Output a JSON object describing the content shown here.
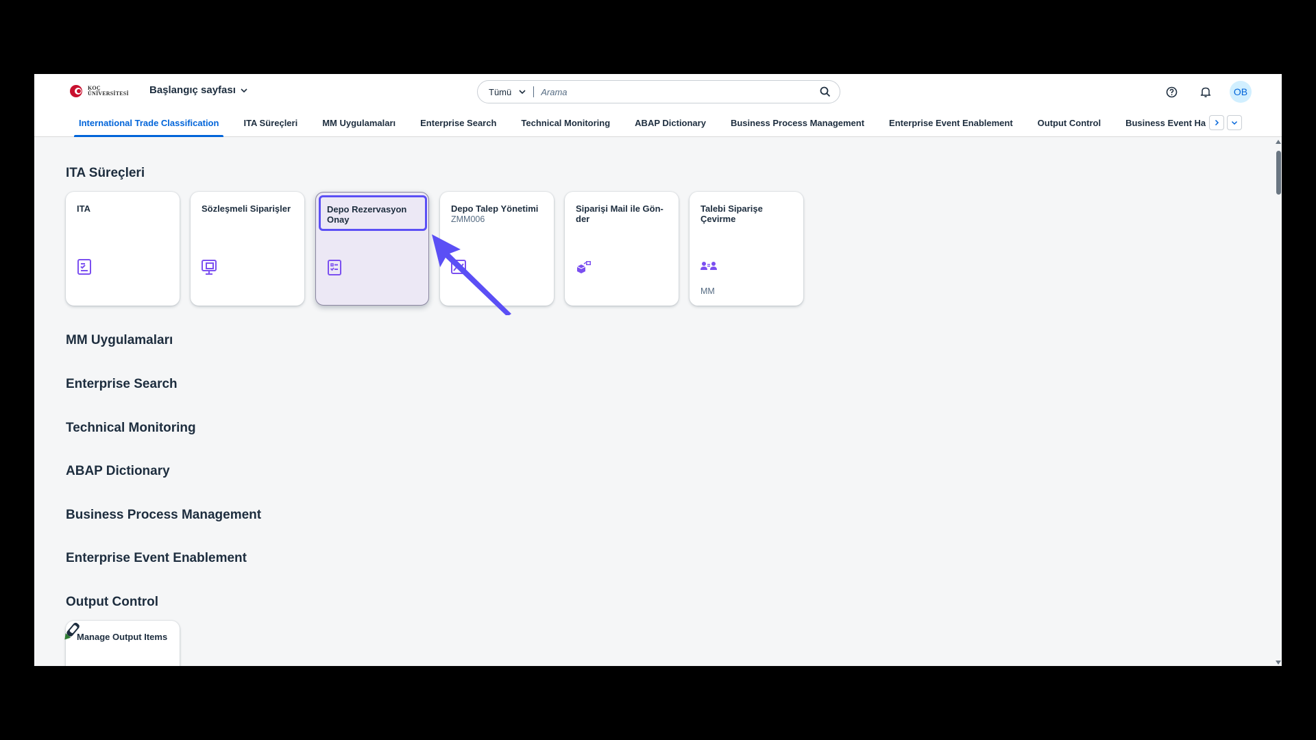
{
  "shell": {
    "logo_line1": "KOÇ",
    "logo_line2": "ÜNİVERSİTESİ",
    "home_title": "Başlangıç sayfası",
    "search": {
      "scope": "Tümü",
      "placeholder": "Arama"
    },
    "avatar_initials": "OB"
  },
  "tabs": [
    {
      "label": "International Trade Classification",
      "active": true
    },
    {
      "label": "ITA Süreçleri"
    },
    {
      "label": "MM Uygulamaları"
    },
    {
      "label": "Enterprise Search"
    },
    {
      "label": "Technical Monitoring"
    },
    {
      "label": "ABAP Dictionary"
    },
    {
      "label": "Business Process Management"
    },
    {
      "label": "Enterprise Event Enablement"
    },
    {
      "label": "Output Control"
    },
    {
      "label": "Business Event Ha"
    }
  ],
  "sections": {
    "ita": "ITA Süreçleri",
    "mm": "MM Uygulamaları",
    "es": "Enterprise Search",
    "tm": "Technical Monitoring",
    "abap": "ABAP Dictionary",
    "bpm": "Business Process Management",
    "eee": "Enterprise Event Enablement",
    "oc": "Output Control"
  },
  "tiles": {
    "ita": {
      "title": "ITA",
      "icon": "clipboard-list-icon"
    },
    "sozlesmeli": {
      "title": "Sözleşmeli Siparişler",
      "icon": "monitor-copy-icon"
    },
    "depo_rez": {
      "title": "Depo Rezervasyon Onay",
      "icon": "checklist-icon"
    },
    "depo_talep": {
      "title": "Depo Talep Yönetimi",
      "subtitle": "ZMM006",
      "icon": "chart-icon"
    },
    "siparis_mail": {
      "title": "Siparişi Mail ile Gön-der",
      "icon": "shipping-boxes-icon"
    },
    "talebi": {
      "title": "Talebi Siparişe Çevirme",
      "footer": "MM",
      "icon": "people-transfer-icon"
    },
    "manage_output": {
      "title": "Manage Output Items"
    }
  },
  "colors": {
    "accent": "#0064d9",
    "icon_purple": "#7b4ff0",
    "focus_ring": "#5b4ff5"
  }
}
